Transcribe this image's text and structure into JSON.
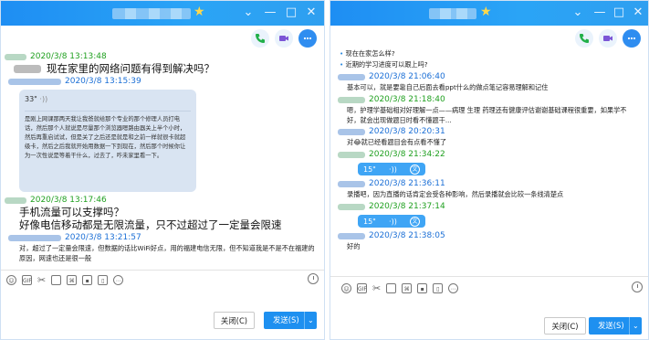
{
  "left": {
    "window_controls": {
      "minimize": "⌄",
      "maximize": "—",
      "restore": "□",
      "close": "✕"
    },
    "entries": [
      {
        "time": "2020/3/8 13:13:48",
        "name_color": "green"
      },
      {
        "text": "现在家里的网络问题有得到解决吗？"
      },
      {
        "time": "2020/3/8 13:15:39",
        "name_color": "blue"
      },
      {
        "voice_duration": "33\"",
        "voice_text": "是刚上网课那两天我让我爸就给那个专业的那个修理人员打电话，然后那个人就说是尽量那个浏览器嗯路由器关上半个小时，然后再重启试试，但是关了之后还是就是和之前一样就很卡就超级卡，然后之后我就开始用数据一下到现在，然后那个时候你让为一次性说是等着干什么，过去了，咋未家里看一下。"
      },
      {
        "time": "2020/3/8 13:17:46",
        "name_color": "green"
      },
      {
        "text": "手机流量可以支撑吗？"
      },
      {
        "text": "好像电信移动都是无限流量，只不过超过了一定量会限速"
      },
      {
        "time": "2020/3/8 13:21:57",
        "name_color": "blue"
      },
      {
        "text": "对，超过了一定量会限速，但数据的话比WiFi好点，用的福建电信无限，但不知道我是不是不在福建的原因，网速也还是很一般"
      }
    ],
    "buttons": {
      "close": "关闭(C)",
      "send": "发送(S)",
      "send_dropdown": "⌄"
    }
  },
  "right": {
    "window_controls": {
      "minimize": "⌄",
      "maximize": "—",
      "restore": "□",
      "close": "✕"
    },
    "entries": [
      {
        "bullet": "现在在家怎么样?"
      },
      {
        "bullet": "近期的学习进度可以跟上吗?"
      },
      {
        "time": "2020/3/8 21:06:40",
        "name_color": "blue"
      },
      {
        "text": "基本可以，就是要靠自己后面去看ppt什么的做点笔记容易理解和记住"
      },
      {
        "time": "2020/3/8 21:18:40",
        "name_color": "green"
      },
      {
        "text": "嗯，护理学基础相对好理解一点——病理 生理 药理还有健康评估谢谢基础课程很重要，如果学不好，就会出现做题日时看不懂题干..."
      },
      {
        "time": "2020/3/8 20:20:31",
        "name_color": "blue"
      },
      {
        "text": "对😂就已经看题目会有点看不懂了"
      },
      {
        "time": "2020/3/8 21:34:22",
        "name_color": "green"
      },
      {
        "voice_duration": "15\""
      },
      {
        "time": "2020/3/8 21:36:11",
        "name_color": "blue"
      },
      {
        "text": "录播吧，因为直播的话肯定会受各种影响，然后录播就会比较一条线清楚点"
      },
      {
        "time": "2020/3/8 21:37:14",
        "name_color": "green"
      },
      {
        "voice_duration": "15\""
      },
      {
        "time": "2020/3/8 21:38:05",
        "name_color": "blue"
      },
      {
        "text": "好的"
      }
    ],
    "buttons": {
      "close": "关闭(C)",
      "send": "发送(S)",
      "send_dropdown": "⌄"
    }
  },
  "toolbar_icons": [
    "emoji-icon",
    "gif-icon",
    "scissors-icon",
    "folder-icon",
    "screenshot-icon",
    "image-icon",
    "shake-icon",
    "more-icon"
  ],
  "colors": {
    "titlebar": "#1e8ef3",
    "send_button": "#1e90f0",
    "green_name": "#20a020",
    "blue_time": "#1b6fd6",
    "phone": "#22b04a",
    "video": "#7b55d6",
    "more": "#2f8df0"
  }
}
